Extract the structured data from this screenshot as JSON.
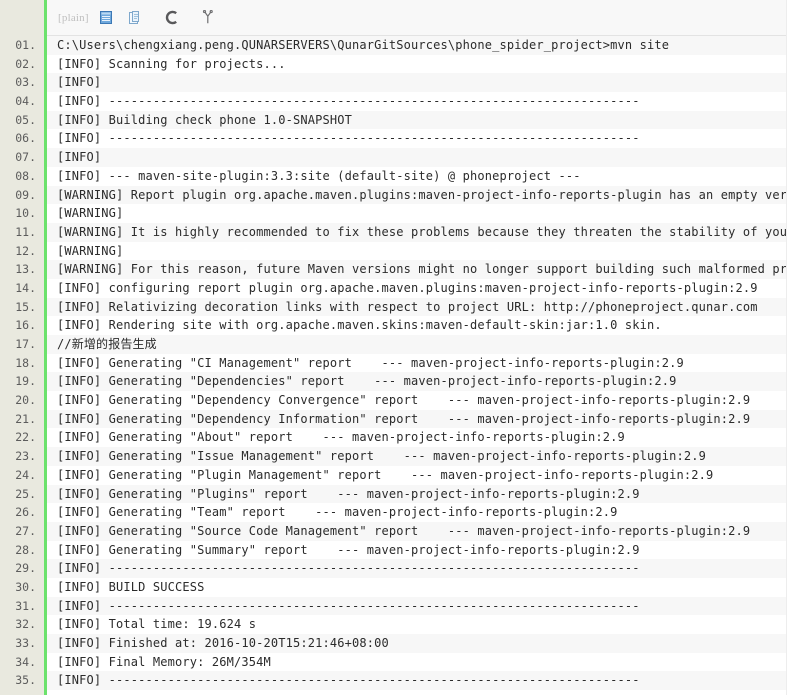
{
  "toolbar": {
    "label": "[plain]",
    "buttons": [
      {
        "name": "view-plain-icon",
        "title": "view plain"
      },
      {
        "name": "copy-to-clipboard-icon",
        "title": "copy to clipboard"
      },
      {
        "name": "refresh-icon",
        "title": "refresh"
      },
      {
        "name": "fork-icon",
        "title": "fork"
      }
    ]
  },
  "colors": {
    "gutter_bg": "#E9E9DF",
    "gutter_rule": "#6CE26C",
    "row_alt": "#F7F7F7",
    "row_bg": "#FFFFFF",
    "text": "#2B2B2B",
    "line_number": "#5C5C5C",
    "toolbar_label": "#BFBFBF"
  },
  "code": {
    "language": "plain",
    "first_line_number": 1,
    "total_lines": 35,
    "lines": [
      {
        "n": "01",
        "text": "C:\\Users\\chengxiang.peng.QUNARSERVERS\\QunarGitSources\\phone_spider_project>mvn site"
      },
      {
        "n": "02",
        "text": "[INFO] Scanning for projects..."
      },
      {
        "n": "03",
        "text": "[INFO]"
      },
      {
        "n": "04",
        "text": "[INFO] ------------------------------------------------------------------------"
      },
      {
        "n": "05",
        "text": "[INFO] Building check phone 1.0-SNAPSHOT"
      },
      {
        "n": "06",
        "text": "[INFO] ------------------------------------------------------------------------"
      },
      {
        "n": "07",
        "text": "[INFO]"
      },
      {
        "n": "08",
        "text": "[INFO] --- maven-site-plugin:3.3:site (default-site) @ phoneproject ---"
      },
      {
        "n": "09",
        "text": "[WARNING] Report plugin org.apache.maven.plugins:maven-project-info-reports-plugin has an empty version."
      },
      {
        "n": "10",
        "text": "[WARNING]"
      },
      {
        "n": "11",
        "text": "[WARNING] It is highly recommended to fix these problems because they threaten the stability of your build."
      },
      {
        "n": "12",
        "text": "[WARNING]"
      },
      {
        "n": "13",
        "text": "[WARNING] For this reason, future Maven versions might no longer support building such malformed projects."
      },
      {
        "n": "14",
        "text": "[INFO] configuring report plugin org.apache.maven.plugins:maven-project-info-reports-plugin:2.9"
      },
      {
        "n": "15",
        "text": "[INFO] Relativizing decoration links with respect to project URL: http://phoneproject.qunar.com"
      },
      {
        "n": "16",
        "text": "[INFO] Rendering site with org.apache.maven.skins:maven-default-skin:jar:1.0 skin."
      },
      {
        "n": "17",
        "text": "//新增的报告生成"
      },
      {
        "n": "18",
        "text": "[INFO] Generating \"CI Management\" report    --- maven-project-info-reports-plugin:2.9"
      },
      {
        "n": "19",
        "text": "[INFO] Generating \"Dependencies\" report    --- maven-project-info-reports-plugin:2.9"
      },
      {
        "n": "20",
        "text": "[INFO] Generating \"Dependency Convergence\" report    --- maven-project-info-reports-plugin:2.9"
      },
      {
        "n": "21",
        "text": "[INFO] Generating \"Dependency Information\" report    --- maven-project-info-reports-plugin:2.9"
      },
      {
        "n": "22",
        "text": "[INFO] Generating \"About\" report    --- maven-project-info-reports-plugin:2.9"
      },
      {
        "n": "23",
        "text": "[INFO] Generating \"Issue Management\" report    --- maven-project-info-reports-plugin:2.9"
      },
      {
        "n": "24",
        "text": "[INFO] Generating \"Plugin Management\" report    --- maven-project-info-reports-plugin:2.9"
      },
      {
        "n": "25",
        "text": "[INFO] Generating \"Plugins\" report    --- maven-project-info-reports-plugin:2.9"
      },
      {
        "n": "26",
        "text": "[INFO] Generating \"Team\" report    --- maven-project-info-reports-plugin:2.9"
      },
      {
        "n": "27",
        "text": "[INFO] Generating \"Source Code Management\" report    --- maven-project-info-reports-plugin:2.9"
      },
      {
        "n": "28",
        "text": "[INFO] Generating \"Summary\" report    --- maven-project-info-reports-plugin:2.9"
      },
      {
        "n": "29",
        "text": "[INFO] ------------------------------------------------------------------------"
      },
      {
        "n": "30",
        "text": "[INFO] BUILD SUCCESS"
      },
      {
        "n": "31",
        "text": "[INFO] ------------------------------------------------------------------------"
      },
      {
        "n": "32",
        "text": "[INFO] Total time: 19.624 s"
      },
      {
        "n": "33",
        "text": "[INFO] Finished at: 2016-10-20T15:21:46+08:00"
      },
      {
        "n": "34",
        "text": "[INFO] Final Memory: 26M/354M"
      },
      {
        "n": "35",
        "text": "[INFO] ------------------------------------------------------------------------"
      }
    ]
  }
}
